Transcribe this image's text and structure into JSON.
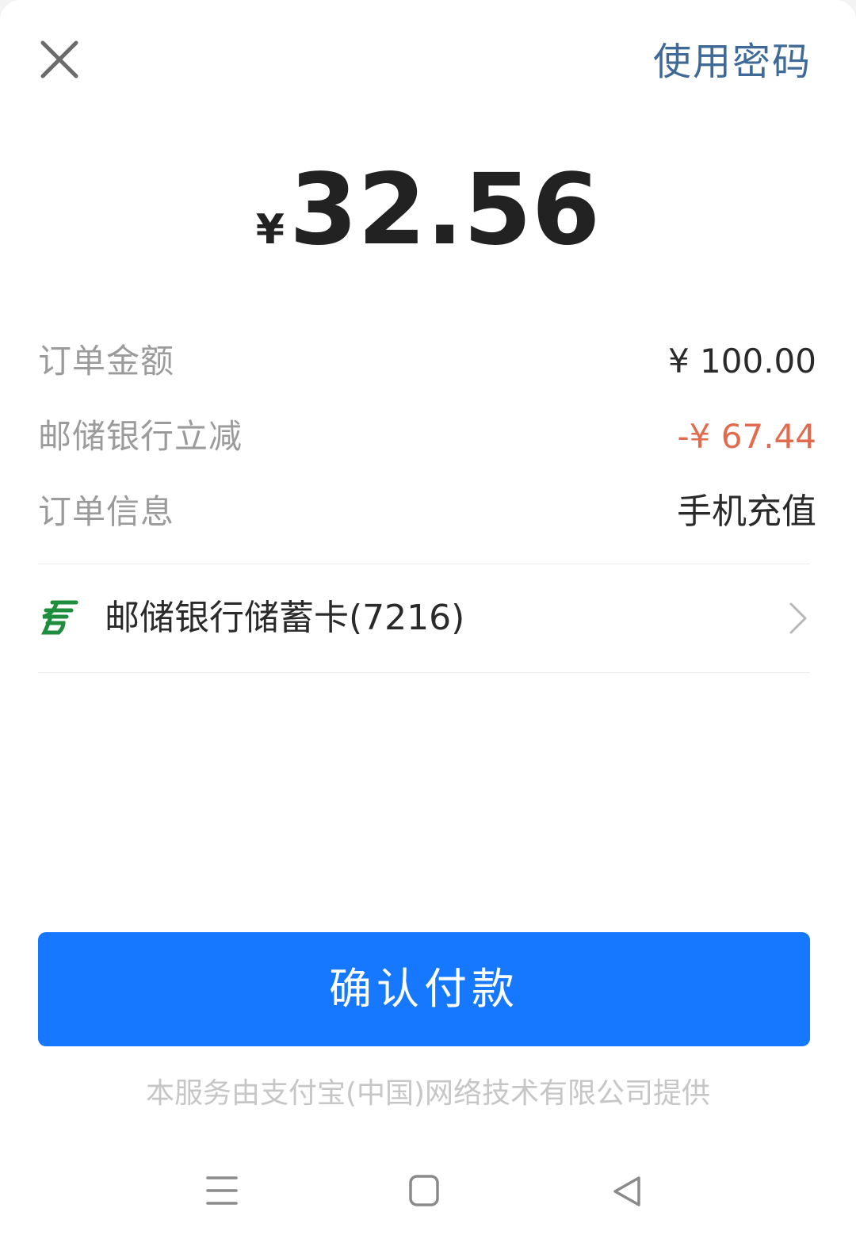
{
  "header": {
    "close_icon": "close-icon",
    "use_password_label": "使用密码"
  },
  "payment": {
    "currency_symbol": "¥",
    "amount": "32.56"
  },
  "details": {
    "order_amount_label": "订单金额",
    "order_amount_value": "¥ 100.00",
    "discount_label": "邮储银行立减",
    "discount_value": "-¥ 67.44",
    "order_info_label": "订单信息",
    "order_info_value": "手机充值"
  },
  "pay_method": {
    "icon": "postal-bank-icon",
    "label": "邮储银行储蓄卡(7216)"
  },
  "confirm_button_label": "确认付款",
  "provider_text": "本服务由支付宝(中国)网络技术有限公司提供",
  "nav_bar": {
    "menu_icon": "menu-icon",
    "home_icon": "home-icon",
    "back_icon": "back-icon"
  },
  "colors": {
    "accent": "#1677ff",
    "link": "#3f6a98",
    "discount": "#e26a4e",
    "bank_green": "#1e8e3e"
  }
}
